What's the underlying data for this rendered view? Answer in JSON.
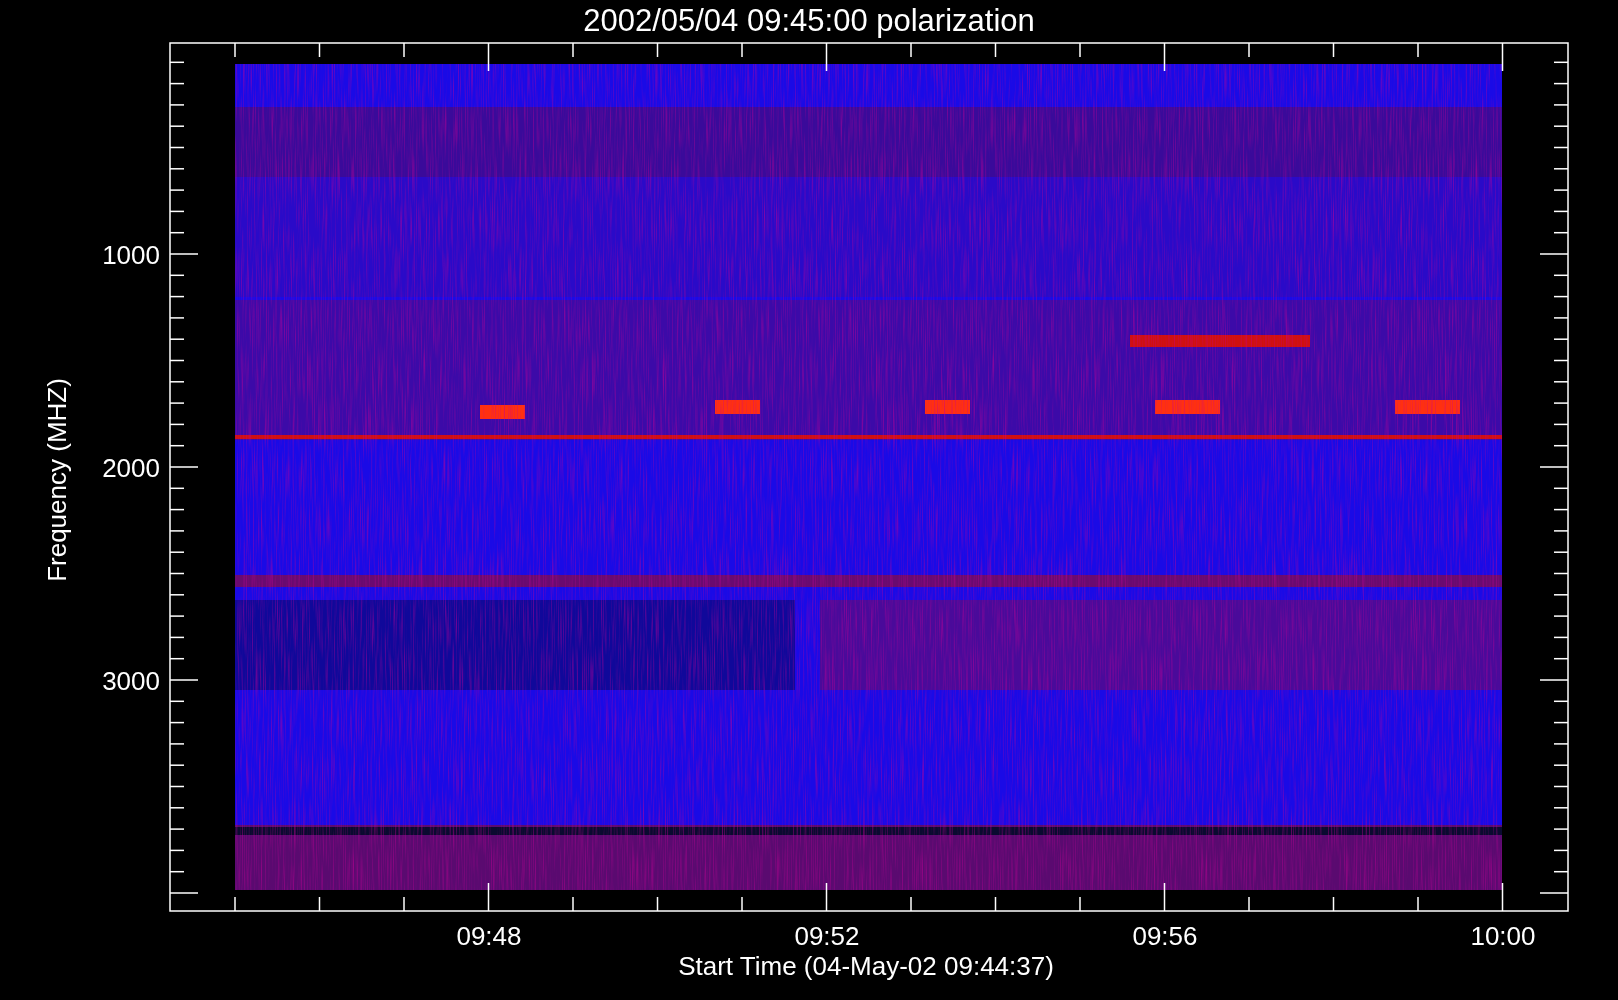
{
  "title": "2002/05/04 09:45:00 polarization",
  "y_axis": {
    "label": "Frequency (MHZ)",
    "ticks": [
      "1000",
      "2000",
      "3000"
    ]
  },
  "x_axis": {
    "label": "Start Time (04-May-02 09:44:37)",
    "ticks": [
      "09:48",
      "09:52",
      "09:56",
      "10:00"
    ]
  }
}
